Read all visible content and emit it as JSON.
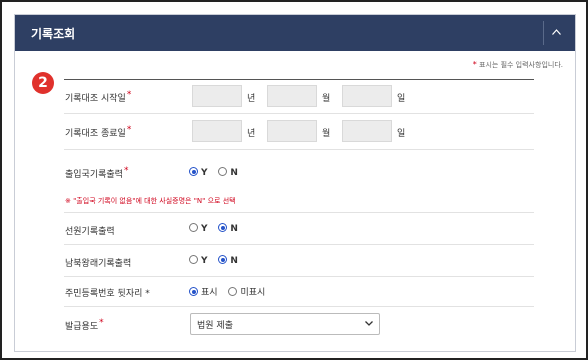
{
  "panel": {
    "title": "기록조회",
    "note_star": "*",
    "note": "표시는 필수 입력사항입니다.",
    "step_number": "2"
  },
  "form": {
    "start_date": {
      "label": "기록대조 시작일",
      "year_unit": "년",
      "month_unit": "월",
      "day_unit": "일"
    },
    "end_date": {
      "label": "기록대조 종료일",
      "year_unit": "년",
      "month_unit": "월",
      "day_unit": "일"
    },
    "immigration": {
      "label": "출입국기록출력",
      "options": [
        "Y",
        "N"
      ],
      "selected": "Y"
    },
    "warning": "※ \"출입국 기록이 없음\"에 대한 사실증명은 \"N\" 으로 선택",
    "seaman": {
      "label": "선원기록출력",
      "options": [
        "Y",
        "N"
      ],
      "selected": "N"
    },
    "inter_korea": {
      "label": "남북왕래기록출력",
      "options": [
        "Y",
        "N"
      ],
      "selected": "N"
    },
    "resident_number": {
      "label": "주민등록번호 뒷자리",
      "options": [
        "표시",
        "미표시"
      ],
      "selected": "표시"
    },
    "purpose": {
      "label": "발급용도",
      "value": "법원 제출"
    },
    "required_mark": "*"
  }
}
